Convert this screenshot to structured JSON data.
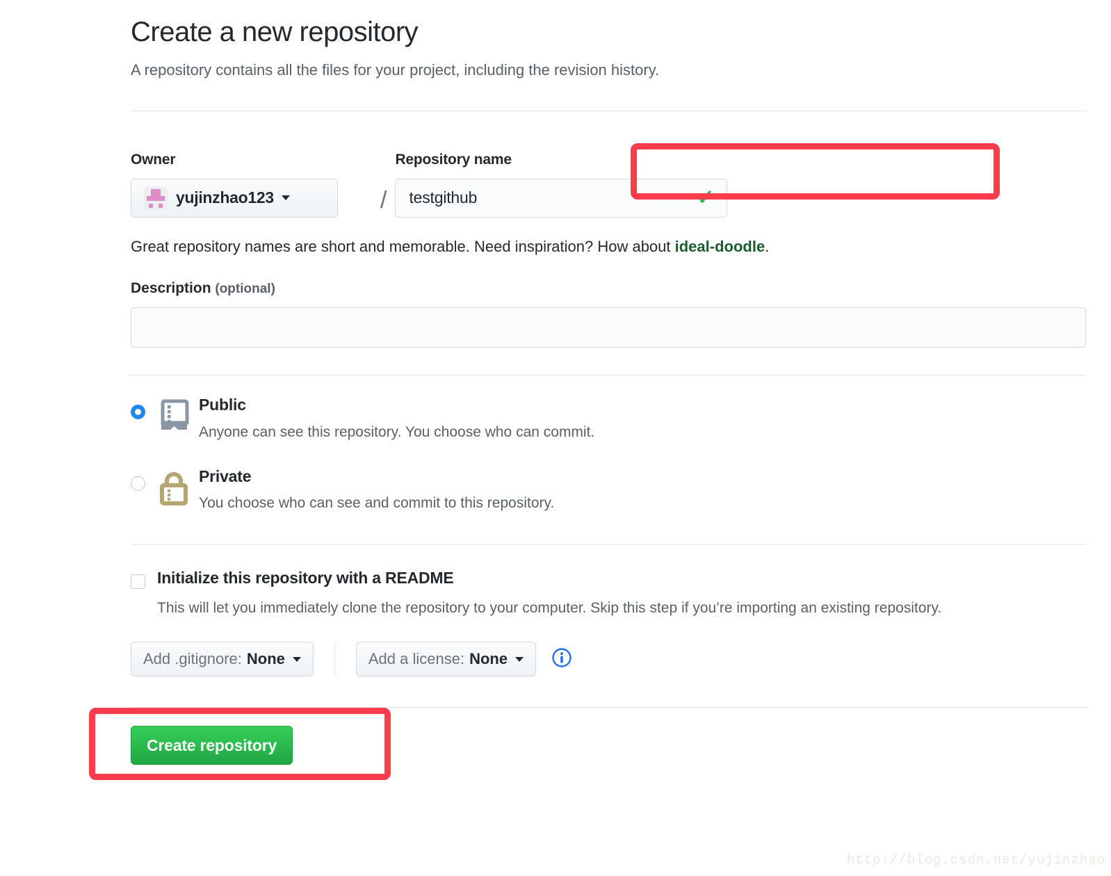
{
  "header": {
    "title": "Create a new repository",
    "subtitle": "A repository contains all the files for your project, including the revision history."
  },
  "owner": {
    "label": "Owner",
    "name": "yujinzhao123",
    "avatar_icon": "identicon-avatar",
    "caret_icon": "chevron-down-icon"
  },
  "separator": "/",
  "repository_name": {
    "label": "Repository name",
    "value": "testgithub",
    "placeholder": "",
    "valid_icon": "checkmark-icon",
    "highlight_color": "#fa3c4c"
  },
  "hint": {
    "prefix": "Great repository names are short and memorable. Need inspiration? How about ",
    "suggestion": "ideal-doodle",
    "suffix": ".",
    "suggestion_color": "#1c5d2e"
  },
  "description": {
    "label": "Description",
    "optional": "(optional)",
    "value": "",
    "placeholder": ""
  },
  "visibility": {
    "options": [
      {
        "id": "public",
        "title": "Public",
        "description": "Anyone can see this repository. You choose who can commit.",
        "icon": "repo-book-icon",
        "icon_color": "#8a96a3",
        "selected": true
      },
      {
        "id": "private",
        "title": "Private",
        "description": "You choose who can see and commit to this repository.",
        "icon": "lock-icon",
        "icon_color": "#b5a572",
        "selected": false
      }
    ],
    "selected_color": "#1f87f0"
  },
  "readme": {
    "label": "Initialize this repository with a README",
    "description": "This will let you immediately clone the repository to your computer. Skip this step if you’re importing an existing repository.",
    "checked": false
  },
  "selects": [
    {
      "id": "gitignore",
      "prefix": "Add .gitignore:",
      "value": "None",
      "caret_icon": "chevron-down-icon"
    },
    {
      "id": "license",
      "prefix": "Add a license:",
      "value": "None",
      "caret_icon": "chevron-down-icon"
    }
  ],
  "info_icon": {
    "name": "info-circle-icon",
    "color": "#1f6feb"
  },
  "submit": {
    "label": "Create repository",
    "color": "#2cbc4e",
    "highlight_color": "#fa3c4c"
  },
  "watermark": "http://blog.csdn.net/yujinzhao"
}
